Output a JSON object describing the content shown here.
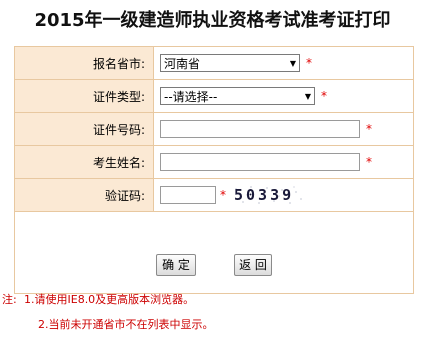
{
  "page": {
    "title": "2015年一级建造师执业资格考试准考证打印"
  },
  "form": {
    "province": {
      "label": "报名省市:",
      "value": "河南省",
      "required_mark": "*"
    },
    "id_type": {
      "label": "证件类型:",
      "value": "--请选择--",
      "required_mark": "*"
    },
    "id_number": {
      "label": "证件号码:",
      "value": "",
      "required_mark": "*"
    },
    "name": {
      "label": "考生姓名:",
      "value": "",
      "required_mark": "*"
    },
    "captcha": {
      "label": "验证码:",
      "value": "",
      "required_mark": "*",
      "image_text": "50339"
    },
    "buttons": {
      "confirm_label": "确 定",
      "back_label": "返 回"
    }
  },
  "notes": {
    "prefix": "注:",
    "line1": "1.请使用IE8.0及更高版本浏览器。",
    "line2": "2.当前未开通省市不在列表中显示。"
  },
  "colors": {
    "label_bg": "#fbe9d4",
    "border": "#e8c8a0",
    "required": "#e00000",
    "note_text": "#cc0000"
  }
}
